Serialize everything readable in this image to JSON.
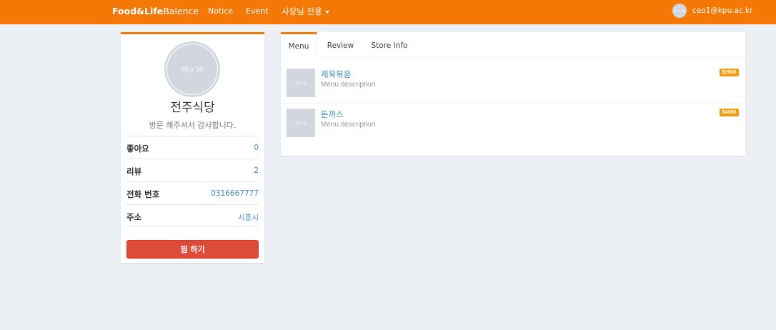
{
  "navbar": {
    "brand_bold": "Food&Life",
    "brand_light": "Balence",
    "links": [
      "Notice",
      "Event"
    ],
    "owner_menu": "사장님 전용",
    "avatar_text": "50 x 50",
    "user_email": "ceo1@kpu.ac.kr"
  },
  "profile": {
    "image_text": "50 x 50",
    "store_name": "전주식당",
    "welcome": "방문 해주셔서 감사합니다.",
    "stats": [
      {
        "label": "좋아요",
        "value": "0"
      },
      {
        "label": "리뷰",
        "value": "2"
      },
      {
        "label": "전화 번호",
        "value": "0316667777"
      },
      {
        "label": "주소",
        "value": "시흥시"
      }
    ],
    "favorite_button": "찜 하기"
  },
  "tabs": [
    "Menu",
    "Review",
    "Store Info"
  ],
  "menu": [
    {
      "thumb": "50 x 50",
      "name": "제육볶음",
      "description": "Menu description",
      "price": "$3500"
    },
    {
      "thumb": "50 x 50",
      "name": "돈까스",
      "description": "Menu description",
      "price": "$4500"
    }
  ],
  "colors": {
    "accent": "#f47806",
    "background": "#ecf0f5",
    "danger": "#dd4b39",
    "link": "#3c8dbc",
    "price_badge": "#f39c12"
  }
}
